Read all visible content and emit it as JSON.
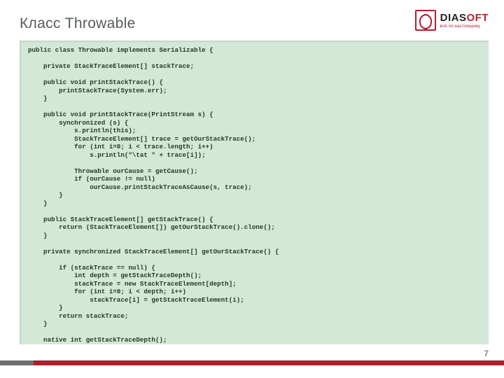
{
  "title": "Класс Throwable",
  "brand": {
    "name_part1": "DIAS",
    "name_part2": "OFT",
    "tagline": "всё по-настоящему"
  },
  "page": "7",
  "code": "public class Throwable implements Serializable {\n\n    private StackTraceElement[] stackTrace;\n\n    public void printStackTrace() {\n        printStackTrace(System.err);\n    }\n\n    public void printStackTrace(PrintStream s) {\n        synchronized (s) {\n            s.println(this);\n            StackTraceElement[] trace = getOurStackTrace();\n            for (int i=0; i < trace.length; i++)\n                s.println(\"\\tat \" + trace[i]);\n\n            Throwable ourCause = getCause();\n            if (ourCause != null)\n                ourCause.printStackTraceAsCause(s, trace);\n        }\n    }\n\n    public StackTraceElement[] getStackTrace() {\n        return (StackTraceElement[]) getOurStackTrace().clone();\n    }\n\n    private synchronized StackTraceElement[] getOurStackTrace() {\n\n        if (stackTrace == null) {\n            int depth = getStackTraceDepth();\n            stackTrace = new StackTraceElement[depth];\n            for (int i=0; i < depth; i++)\n                stackTrace[i] = getStackTraceElement(i);\n        }\n        return stackTrace;\n    }\n\n    native int getStackTraceDepth();\n\n}"
}
